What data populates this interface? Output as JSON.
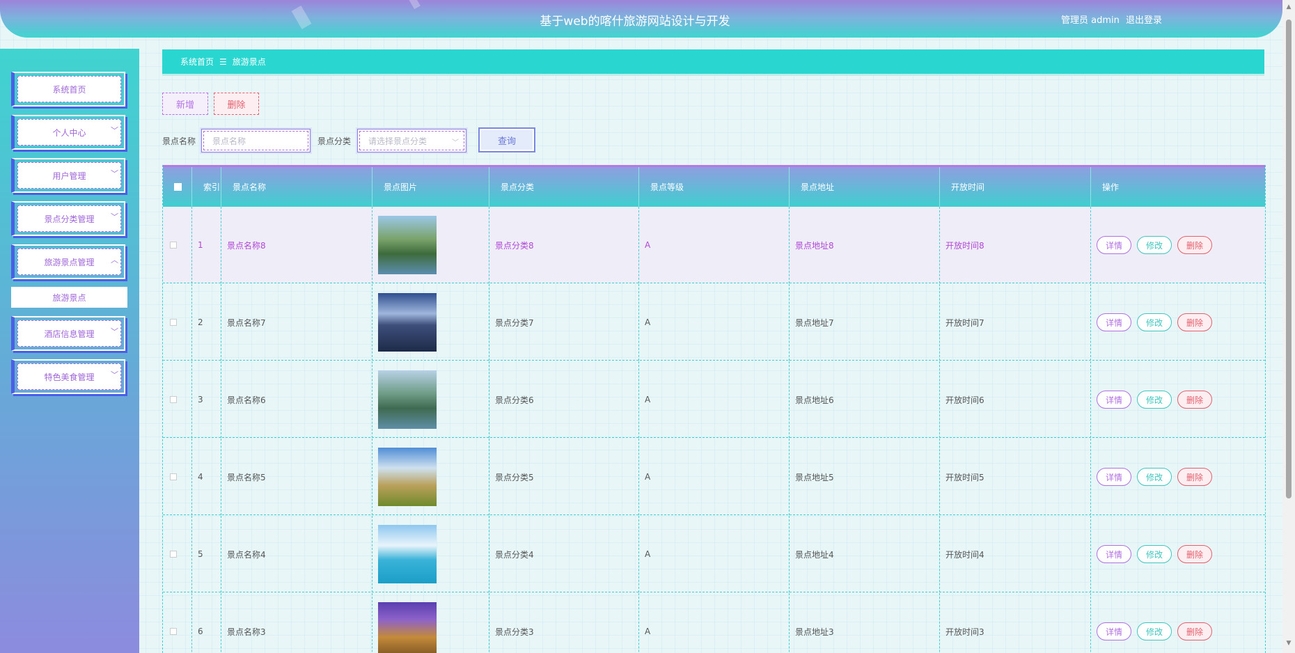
{
  "header": {
    "title": "基于web的喀什旅游网站设计与开发",
    "user": "管理员 admin",
    "logout": "退出登录"
  },
  "sidebar": {
    "items": [
      {
        "label": "系统首页",
        "has_chevron": false
      },
      {
        "label": "个人中心",
        "has_chevron": true
      },
      {
        "label": "用户管理",
        "has_chevron": true
      },
      {
        "label": "景点分类管理",
        "has_chevron": true
      },
      {
        "label": "旅游景点管理",
        "has_chevron": true,
        "expanded": true
      },
      {
        "label": "酒店信息管理",
        "has_chevron": true
      },
      {
        "label": "特色美食管理",
        "has_chevron": true
      }
    ],
    "submenu": {
      "label": "旅游景点"
    }
  },
  "breadcrumb": {
    "home": "系统首页",
    "separator": "☰",
    "current": "旅游景点"
  },
  "toolbar": {
    "add_label": "新增",
    "delete_label": "删除"
  },
  "search": {
    "name_label": "景点名称",
    "name_placeholder": "景点名称",
    "category_label": "景点分类",
    "category_placeholder": "请选择景点分类",
    "query_label": "查询"
  },
  "table": {
    "headers": [
      "索引",
      "景点名称",
      "景点图片",
      "景点分类",
      "景点等级",
      "景点地址",
      "开放时间",
      "操作"
    ],
    "rows": [
      {
        "index": "1",
        "name": "景点名称8",
        "category": "景点分类8",
        "level": "A",
        "address": "景点地址8",
        "time": "开放时间8"
      },
      {
        "index": "2",
        "name": "景点名称7",
        "category": "景点分类7",
        "level": "A",
        "address": "景点地址7",
        "time": "开放时间7"
      },
      {
        "index": "3",
        "name": "景点名称6",
        "category": "景点分类6",
        "level": "A",
        "address": "景点地址6",
        "time": "开放时间6"
      },
      {
        "index": "4",
        "name": "景点名称5",
        "category": "景点分类5",
        "level": "A",
        "address": "景点地址5",
        "time": "开放时间5"
      },
      {
        "index": "5",
        "name": "景点名称4",
        "category": "景点分类4",
        "level": "A",
        "address": "景点地址4",
        "time": "开放时间4"
      },
      {
        "index": "6",
        "name": "景点名称3",
        "category": "景点分类3",
        "level": "A",
        "address": "景点地址3",
        "time": "开放时间3"
      }
    ],
    "actions": {
      "detail": "详情",
      "edit": "修改",
      "delete": "删除"
    }
  },
  "colors": {
    "accent_teal": "#2ad6d0",
    "accent_purple": "#b16fe0",
    "danger": "#e35f6d",
    "menu_border": "#4b5ee6"
  }
}
